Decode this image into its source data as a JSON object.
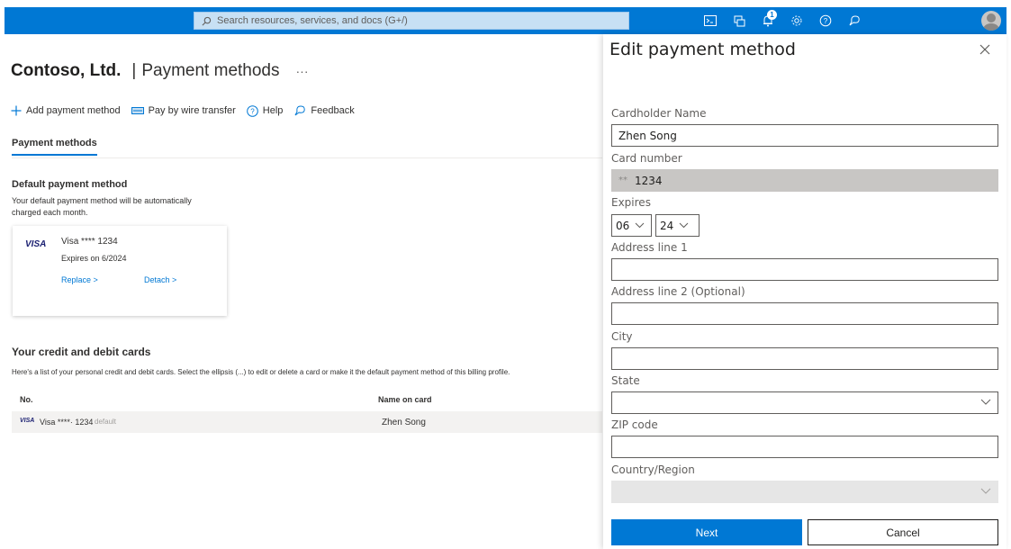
{
  "topbar": {
    "search_placeholder": "Search resources, services, and docs (G+/)",
    "notification_count": "1",
    "icons": [
      "cloud-shell-icon",
      "directory-filter-icon",
      "notifications-icon",
      "settings-icon",
      "help-icon",
      "feedback-icon"
    ],
    "accent": "#0078d4"
  },
  "page": {
    "org": "Contoso, Ltd.",
    "separator": "|",
    "title": "Payment methods",
    "more": "···"
  },
  "toolbar": {
    "add_label": "Add payment method",
    "wire_label": "Pay by wire transfer",
    "help_label": "Help",
    "feedback_label": "Feedback"
  },
  "tabs": {
    "active": "Payment methods"
  },
  "default_method": {
    "title": "Default payment method",
    "description": "Your default payment method will be automatically charged each month.",
    "card_brand": "VISA",
    "card_name": "Visa **** 1234",
    "expires": "Expires on 6/2024",
    "replace_label": "Replace >",
    "detach_label": "Detach >"
  },
  "cards_section": {
    "title": "Your credit and debit cards",
    "description": "Here's a list of your personal credit and debit cards. Select the ellipsis (...) to edit or delete a card or make it the default payment method of this billing profile.",
    "columns": [
      "No.",
      "Name on card"
    ],
    "rows": [
      {
        "brand": "VISA",
        "card": "Visa ****· 1234",
        "tag": "default",
        "name": "Zhen Song"
      }
    ]
  },
  "panel": {
    "title": "Edit payment method",
    "cardholder_label": "Cardholder Name",
    "cardholder_value": "Zhen Song",
    "card_number_label": "Card number",
    "card_number_dots": "**",
    "card_number_value": "1234",
    "expires_label": "Expires",
    "exp_month": "06",
    "exp_year": "24",
    "address1_label": "Address line 1",
    "address1_value": "",
    "address2_label": "Address line 2 (Optional)",
    "address2_value": "",
    "city_label": "City",
    "city_value": "",
    "state_label": "State",
    "state_value": "",
    "zip_label": "ZIP code",
    "zip_value": "",
    "country_label": "Country/Region",
    "country_value": "",
    "next_label": "Next",
    "cancel_label": "Cancel"
  }
}
